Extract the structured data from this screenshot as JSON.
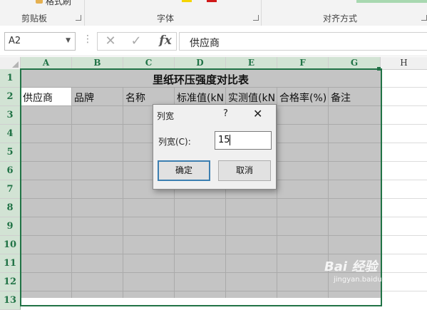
{
  "ribbon": {
    "clipboard_group": "剪贴板",
    "font_group": "字体",
    "alignment_group": "对齐方式",
    "format_painter_partial": "格式刷"
  },
  "formula_bar": {
    "name_box": "A2",
    "content": "供应商",
    "dots": "⋮",
    "cancel_icon": "✕",
    "enter_icon": "✓",
    "fx_label": "fx"
  },
  "columns": [
    "A",
    "B",
    "C",
    "D",
    "E",
    "F",
    "G",
    "H"
  ],
  "rows": [
    "1",
    "2",
    "3",
    "4",
    "5",
    "6",
    "7",
    "8",
    "9",
    "10",
    "11",
    "12",
    "13"
  ],
  "sheet": {
    "title": "里纸环压强度对比表",
    "headers": [
      "供应商",
      "品牌",
      "名称",
      "标准值(kN",
      "实测值(kN",
      "合格率(%)",
      "备注"
    ]
  },
  "dialog": {
    "title": "列宽",
    "help": "?",
    "close": "✕",
    "label": "列宽(C):",
    "value": "15",
    "ok": "确定",
    "cancel": "取消"
  },
  "watermark": {
    "text": "Bai 经验",
    "url": "jingyan.baidu.com"
  },
  "colors": {
    "excel_green": "#217346",
    "selection_fill": "#c4c4c4",
    "header_highlight": "#d2e3d4"
  }
}
